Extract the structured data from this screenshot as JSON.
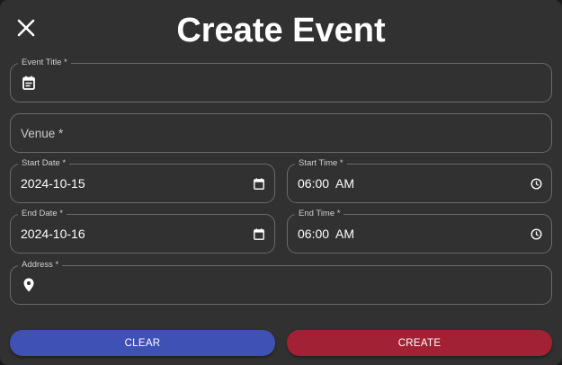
{
  "dialog": {
    "title": "Create Event",
    "close_icon": "close-icon"
  },
  "fields": {
    "event_title": {
      "label": "Event Title *",
      "value": "",
      "icon": "calendar-event-icon"
    },
    "venue": {
      "label": "Venue *",
      "placeholder": "Venue *",
      "value": ""
    },
    "start_date": {
      "label": "Start Date *",
      "value": "2024-10-15",
      "icon": "calendar-icon"
    },
    "start_time": {
      "label": "Start Time *",
      "value": "06:00  AM",
      "icon": "clock-icon"
    },
    "end_date": {
      "label": "End Date *",
      "value": "2024-10-16",
      "icon": "calendar-icon"
    },
    "end_time": {
      "label": "End Time *",
      "value": "06:00  AM",
      "icon": "clock-icon"
    },
    "address": {
      "label": "Address *",
      "value": "",
      "icon": "location-pin-icon"
    }
  },
  "actions": {
    "clear_label": "CLEAR",
    "create_label": "CREATE"
  },
  "colors": {
    "background": "#313131",
    "clear_button": "#3f51b5",
    "create_button": "#a32134",
    "field_border": "#6a6a6a"
  }
}
